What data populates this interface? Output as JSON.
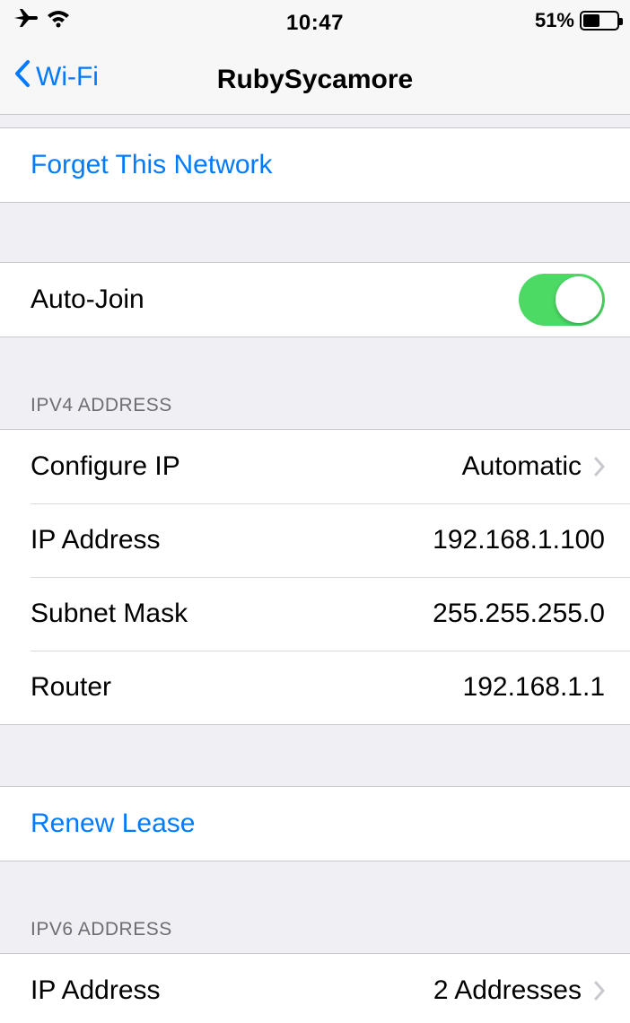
{
  "status_bar": {
    "time": "10:47",
    "battery_percent": "51%",
    "battery_level": 0.51
  },
  "nav": {
    "back_label": "Wi-Fi",
    "title": "RubySycamore"
  },
  "forget_network": {
    "label": "Forget This Network"
  },
  "auto_join": {
    "label": "Auto-Join",
    "enabled": true,
    "toggle_color": "#4cd964"
  },
  "ipv4": {
    "header": "IPV4 ADDRESS",
    "rows": [
      {
        "label": "Configure IP",
        "value": "Automatic"
      },
      {
        "label": "IP Address",
        "value": "192.168.1.100"
      },
      {
        "label": "Subnet Mask",
        "value": "255.255.255.0"
      },
      {
        "label": "Router",
        "value": "192.168.1.1"
      }
    ]
  },
  "renew_lease": {
    "label": "Renew Lease"
  },
  "ipv6": {
    "header": "IPV6 ADDRESS",
    "rows": [
      {
        "label": "IP Address",
        "value": "2 Addresses"
      }
    ]
  },
  "colors": {
    "accent": "#007aff",
    "background": "#efeff4"
  },
  "icons": [
    "airplane-icon",
    "wifi-icon",
    "battery-icon",
    "chevron-left-icon",
    "chevron-right-icon"
  ]
}
